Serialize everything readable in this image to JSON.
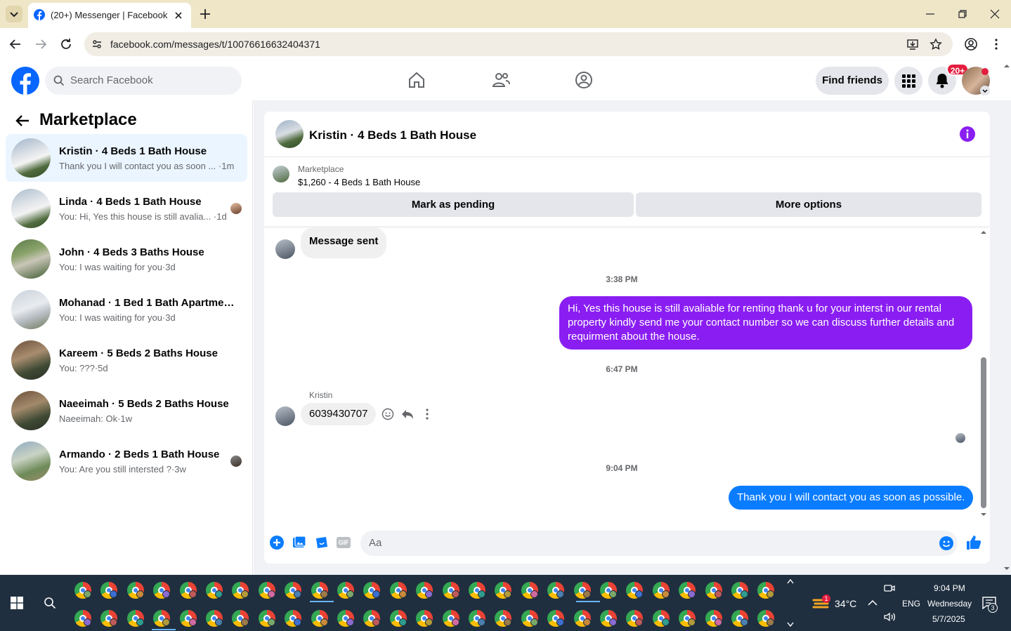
{
  "browser": {
    "tab_title": "(20+) Messenger | Facebook",
    "url": "facebook.com/messages/t/10076616632404371"
  },
  "fb_header": {
    "search_placeholder": "Search Facebook",
    "find_friends_label": "Find friends",
    "notification_badge": "20+"
  },
  "left_panel": {
    "title": "Marketplace",
    "conversations": [
      {
        "name": "Kristin · 4 Beds 1 Bath House",
        "preview": "Thank you I will contact you as soon ... ·1m",
        "active": true
      },
      {
        "name": "Linda · 4 Beds 1 Bath House",
        "preview": "You: Hi, Yes this house is still avalia... ·1d",
        "active": false
      },
      {
        "name": "John · 4 Beds 3 Baths House",
        "preview": "You: I was waiting for you·3d",
        "active": false
      },
      {
        "name": "Mohanad · 1 Bed 1 Bath Apartmen...",
        "preview": "You: I was waiting for you·3d",
        "active": false
      },
      {
        "name": "Kareem · 5 Beds 2 Baths House",
        "preview": "You: ???·5d",
        "active": false
      },
      {
        "name": "Naeeimah · 5 Beds 2 Baths House",
        "preview": "Naeeimah: Ok·1w",
        "active": false
      },
      {
        "name": "Armando · 2 Beds 1 Bath House",
        "preview": "You: Are you still intersted ?·3w",
        "active": false
      }
    ]
  },
  "chat": {
    "title": "Kristin · 4 Beds 1 Bath House",
    "listing_label": "Marketplace",
    "listing_price": "$1,260 - 4 Beds 1 Bath House",
    "mark_pending_label": "Mark as pending",
    "more_options_label": "More options",
    "messages": {
      "sent_notice": "Message sent",
      "time1": "3:38 PM",
      "out1": "Hi, Yes this house is still avaliable for renting thank u for your interst in our rental property kindly send me your contact number so we can discuss further details and requirment about the house.",
      "time2": "6:47 PM",
      "sender": "Kristin",
      "in1": "6039430707",
      "time3": "9:04 PM",
      "out2": "Thank you I will contact  you as soon as possible."
    },
    "composer_placeholder": "Aa",
    "gif_label": "GIF"
  },
  "taskbar": {
    "temperature": "34°C",
    "language": "ENG",
    "time": "9:04 PM",
    "day": "Wednesday",
    "date": "5/7/2025",
    "weather_badge": "1",
    "notification_count": "3"
  },
  "colors": {
    "fb_blue": "#0866ff",
    "purple_bubble": "#8a1ef2",
    "blue_bubble": "#0a7cff",
    "active_row": "#ebf5ff",
    "badge_red": "#e41e3f"
  }
}
